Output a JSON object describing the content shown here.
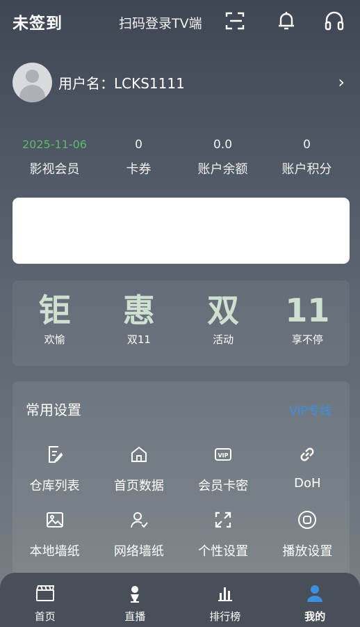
{
  "header": {
    "status": "未签到",
    "scan_label": "扫码登录TV端",
    "icons": [
      "scan-icon",
      "bell-icon",
      "headset-icon"
    ]
  },
  "profile": {
    "username": "用户名：LCKS1111",
    "chevron": "›"
  },
  "stats": [
    {
      "value": "2025-11-06",
      "label": "影视会员",
      "highlight": "#5fb86b"
    },
    {
      "value": "0",
      "label": "卡券"
    },
    {
      "value": "0.0",
      "label": "账户余额"
    },
    {
      "value": "0",
      "label": "账户积分"
    }
  ],
  "promo": [
    {
      "glyph": "钜",
      "label": "欢愉"
    },
    {
      "glyph": "惠",
      "label": "双11"
    },
    {
      "glyph": "双",
      "label": "活动"
    },
    {
      "glyph": "11",
      "label": "享不停"
    }
  ],
  "settings": {
    "title": "常用设置",
    "vip_label": "VIP专线",
    "items": [
      {
        "label": "仓库列表",
        "icon": "edit-doc-icon"
      },
      {
        "label": "首页数据",
        "icon": "home-icon"
      },
      {
        "label": "会员卡密",
        "icon": "vip-card-icon"
      },
      {
        "label": "DoH",
        "icon": "link-icon"
      },
      {
        "label": "本地墙纸",
        "icon": "image-icon"
      },
      {
        "label": "网络墙纸",
        "icon": "user-check-icon"
      },
      {
        "label": "个性设置",
        "icon": "expand-icon"
      },
      {
        "label": "播放设置",
        "icon": "record-icon"
      }
    ]
  },
  "tabbar": {
    "items": [
      {
        "label": "首页",
        "icon": "clapperboard-icon"
      },
      {
        "label": "直播",
        "icon": "live-icon"
      },
      {
        "label": "排行榜",
        "icon": "bar-chart-icon"
      },
      {
        "label": "我的",
        "icon": "person-icon",
        "active": true
      }
    ],
    "active_color": "#3d8fe0"
  }
}
